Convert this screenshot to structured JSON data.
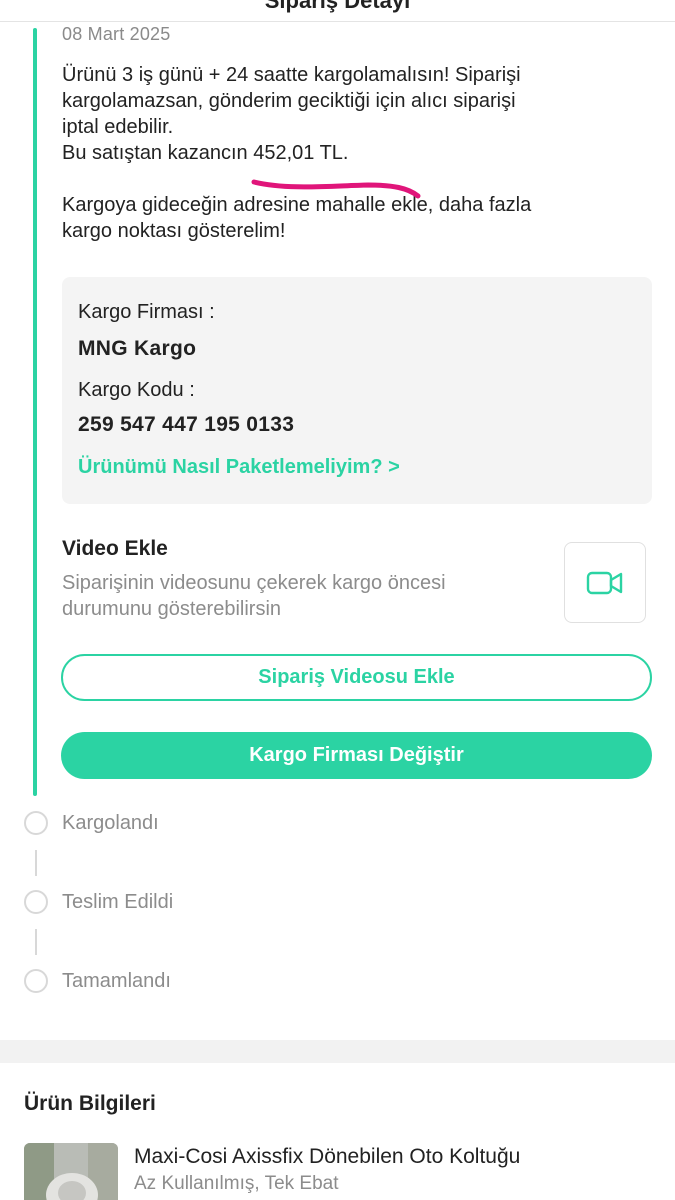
{
  "header": {
    "title": "Sipariş Detayı"
  },
  "order_event": {
    "date": "08 Mart 2025",
    "lines": [
      "Ürünü 3 iş günü + 24 saatte kargolamalısın! Siparişi",
      "kargolamazsan, gönderim geciktiği için alıcı siparişi",
      "iptal edebilir.",
      "Bu satıştan kazancın 452,01 TL."
    ],
    "lines2": [
      "Kargoya gideceğin adresine mahalle ekle, daha fazla",
      "kargo noktası gösterelim!"
    ]
  },
  "cargo": {
    "company_label": "Kargo Firması :",
    "company_value": "MNG Kargo",
    "code_label": "Kargo Kodu :",
    "code_value": "259 547 447 195 0133",
    "packaging_link": "Ürünümü Nasıl Paketlemeliyim? >"
  },
  "video": {
    "title": "Video Ekle",
    "desc_lines": [
      "Siparişinin videosunu çekerek kargo öncesi",
      "durumunu gösterebilirsin"
    ],
    "icon": "video-camera-icon"
  },
  "buttons": {
    "add_video": "Sipariş Videosu Ekle",
    "change_cargo": "Kargo Firması Değiştir"
  },
  "steps": [
    "Kargolandı",
    "Teslim Edildi",
    "Tamamlandı"
  ],
  "product_section": {
    "title": "Ürün Bilgileri",
    "name": "Maxi-Cosi Axissfix Dönebilen Oto Koltuğu",
    "condition": "Az Kullanılmış, Tek Ebat"
  },
  "colors": {
    "accent": "#2bd3a3",
    "text": "#222222",
    "muted": "#8c8c8c",
    "annotation": "#e0157a"
  }
}
